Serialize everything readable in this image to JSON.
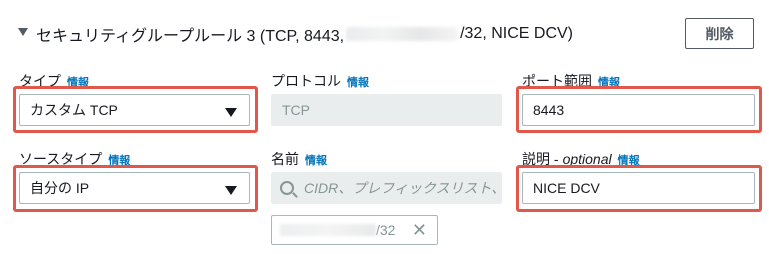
{
  "rule": {
    "title_prefix": "セキュリティグループルール 3 (TCP, 8443,",
    "title_suffix": "/32, NICE DCV)",
    "delete_label": "削除"
  },
  "fields": {
    "type": {
      "label": "タイプ",
      "info": "情報",
      "value": "カスタム TCP"
    },
    "protocol": {
      "label": "プロトコル",
      "info": "情報",
      "value": "TCP"
    },
    "port_range": {
      "label": "ポート範囲",
      "info": "情報",
      "value": "8443"
    },
    "source_type": {
      "label": "ソースタイプ",
      "info": "情報",
      "value": "自分の IP"
    },
    "name": {
      "label": "名前",
      "info": "情報",
      "placeholder": "CIDR、プレフィックスリスト、",
      "token_suffix": "/32",
      "token_remove": "✕"
    },
    "description": {
      "label": "説明 -",
      "optional": "optional",
      "info": "情報",
      "value": "NICE DCV"
    }
  },
  "colors": {
    "highlight": "#e0574b",
    "link": "#0073bb"
  },
  "icons": [
    "caret-down-icon",
    "dropdown-arrow-icon",
    "search-icon",
    "close-icon"
  ]
}
